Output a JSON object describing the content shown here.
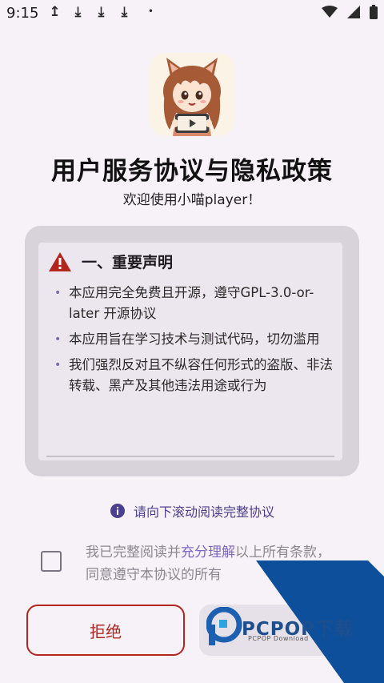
{
  "status_bar": {
    "time": "9:15",
    "notif_glyphs": [
      "↥",
      "⤓",
      "⤓",
      "⤓"
    ],
    "dot": "•"
  },
  "header": {
    "title": "用户服务协议与隐私政策",
    "subtitle": "欢迎使用小喵player！"
  },
  "agreement": {
    "section_title": "一、重要声明",
    "bullets": [
      "本应用完全免费且开源，遵守GPL-3.0-or-later 开源协议",
      "本应用旨在学习技术与测试代码，切勿滥用",
      "我们强烈反对且不纵容任何形式的盗版、非法转载、黑产及其他违法用途或行为"
    ]
  },
  "scroll_hint": {
    "text": "请向下滚动阅读完整协议"
  },
  "consent": {
    "prefix": "我已完整阅读并",
    "highlight": "充分理解",
    "suffix": "以上所有条款，同意遵守本协议的所有",
    "checked": false
  },
  "buttons": {
    "reject": "拒绝",
    "accept": ""
  },
  "watermark": {
    "brand": "PCPOP下载",
    "sub": "PCPOP Download"
  },
  "colors": {
    "accent": "#7b68c4",
    "danger": "#b3261e",
    "warning": "#b3261e",
    "watermark_blue": "#0d4f9b"
  }
}
